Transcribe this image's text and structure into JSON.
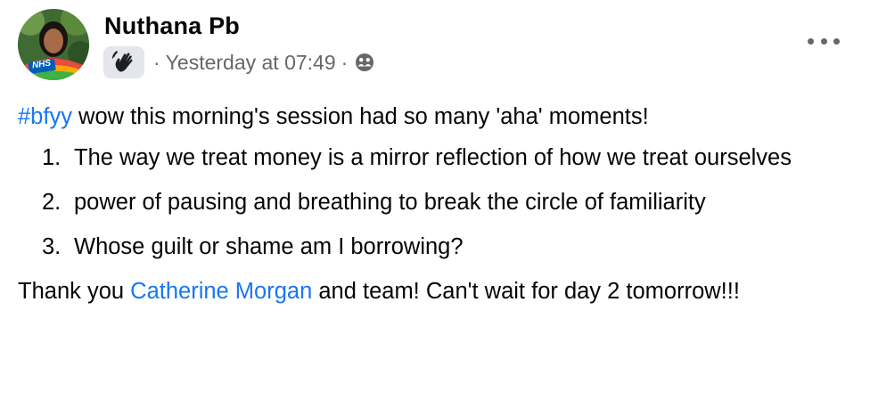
{
  "post": {
    "author": "Nuthana Pb",
    "avatar_badge_text": "NHS",
    "badge_icon": "waving-hand-icon",
    "separator": "·",
    "timestamp": "Yesterday at 07:49",
    "audience_icon": "friends-audience-icon",
    "more_icon": "more-options-icon",
    "hashtag": "#bfyy",
    "intro_text": " wow this morning's session had so many 'aha' moments!",
    "points": [
      {
        "num": "1.",
        "text": "The way we treat money is a mirror reflection of how we treat ourselves"
      },
      {
        "num": "2.",
        "text": "power of pausing and breathing to break the circle of familiarity"
      },
      {
        "num": "3.",
        "text": "Whose guilt or shame am I borrowing?"
      }
    ],
    "closing_before": "Thank you ",
    "mention": "Catherine Morgan",
    "closing_after": " and team! Can't wait for day 2 tomorrow!!!"
  },
  "colors": {
    "link": "#1877f2",
    "text": "#050505",
    "secondary_text": "#65676b"
  }
}
